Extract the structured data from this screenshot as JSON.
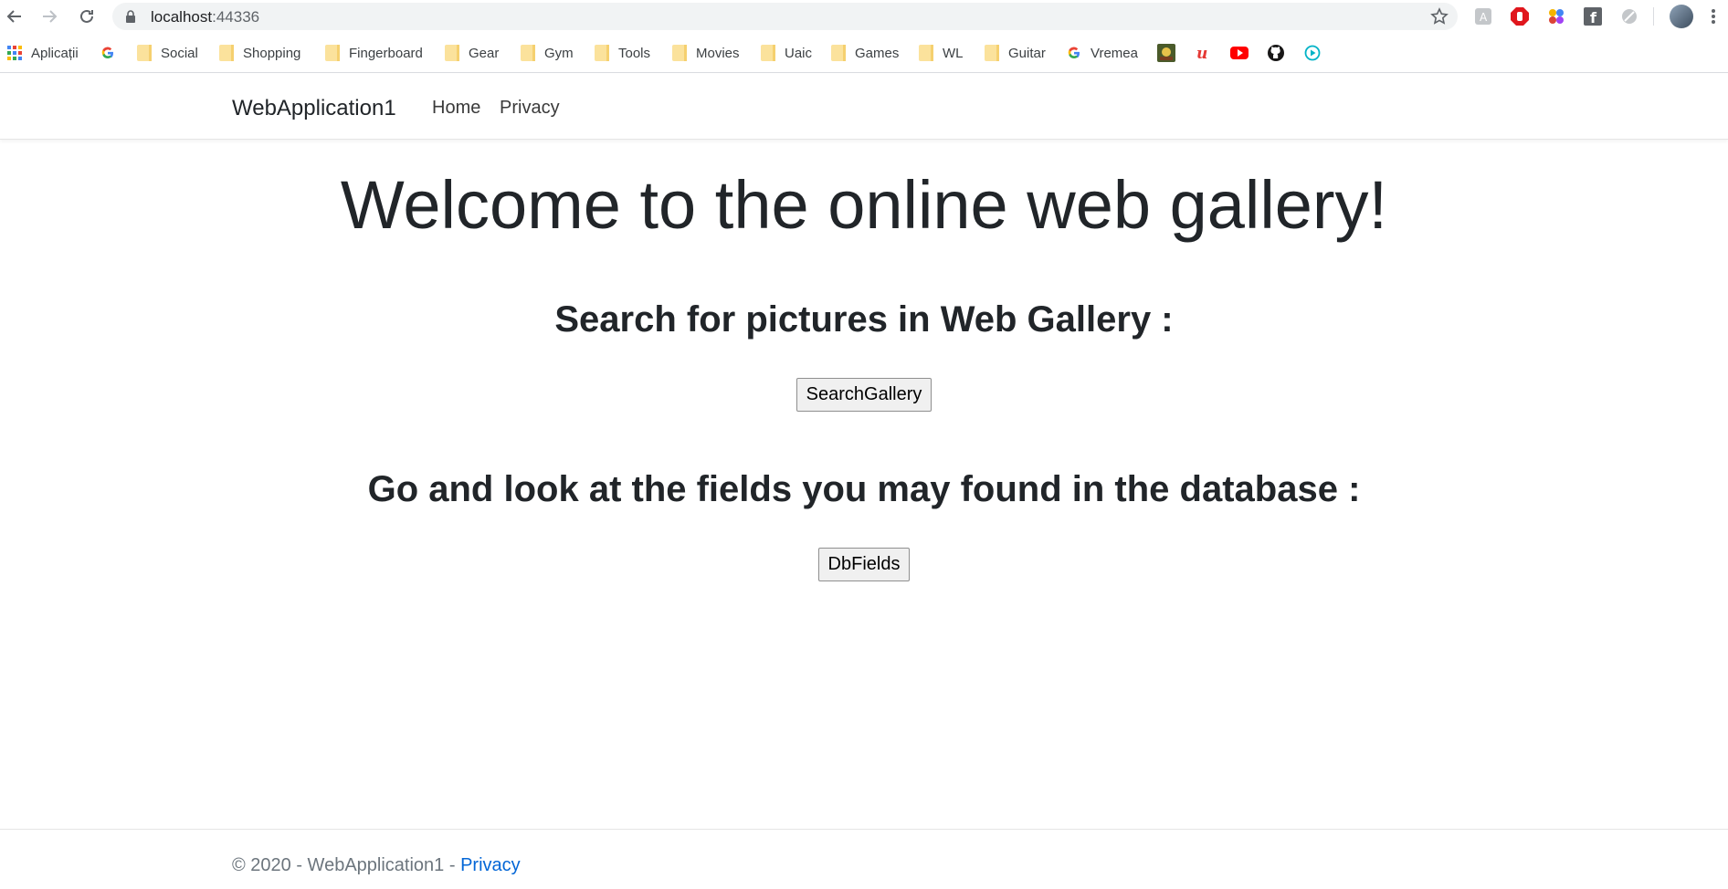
{
  "browser": {
    "url_host": "localhost",
    "url_port": ":44336",
    "bookmarks": [
      {
        "label": "Aplicații",
        "icon": "apps-grid-icon"
      },
      {
        "label": "",
        "icon": "google-icon"
      },
      {
        "label": "Social",
        "icon": "folder-icon"
      },
      {
        "label": "Shopping",
        "icon": "folder-icon"
      },
      {
        "label": "Fingerboard",
        "icon": "folder-icon"
      },
      {
        "label": "Gear",
        "icon": "folder-icon"
      },
      {
        "label": "Gym",
        "icon": "folder-icon"
      },
      {
        "label": "Tools",
        "icon": "folder-icon"
      },
      {
        "label": "Movies",
        "icon": "folder-icon"
      },
      {
        "label": "Uaic",
        "icon": "folder-icon"
      },
      {
        "label": "Games",
        "icon": "folder-icon"
      },
      {
        "label": "WL",
        "icon": "folder-icon"
      },
      {
        "label": "Guitar",
        "icon": "folder-icon"
      },
      {
        "label": "Vremea",
        "icon": "google-icon"
      }
    ]
  },
  "site": {
    "brand": "WebApplication1",
    "nav": [
      "Home",
      "Privacy"
    ]
  },
  "main": {
    "title": "Welcome to the online web gallery!",
    "search_heading": "Search for pictures in Web Gallery :",
    "search_button": "SearchGallery",
    "db_heading": "Go and look at the fields you may found in the database :",
    "db_button": "DbFields"
  },
  "footer": {
    "text": "© 2020 - WebApplication1 - ",
    "link": "Privacy"
  },
  "colors": {
    "link": "#0366d6",
    "text": "#212529",
    "muted": "#6c757d"
  }
}
